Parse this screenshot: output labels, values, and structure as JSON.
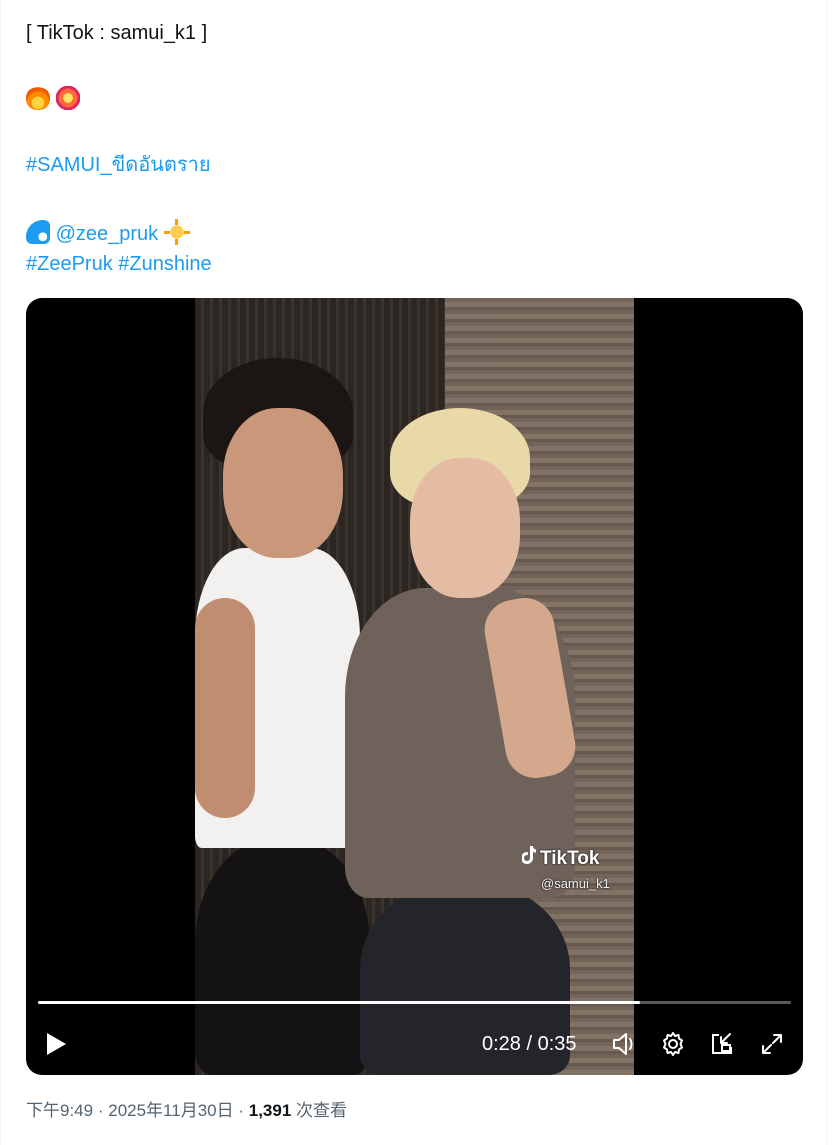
{
  "tweet": {
    "line1": "[ TikTok : samui_k1 ]",
    "emoji_line": [
      "fire-emoji",
      "collision-emoji"
    ],
    "hashtag_samui": "#SAMUI_ขีดอันตราย",
    "mention": "@zee_pruk",
    "hashtag_zeepruk": "#ZeePruk",
    "hashtag_zunshine": "#Zunshine"
  },
  "video": {
    "watermark_brand": "TikTok",
    "watermark_handle": "@samui_k1",
    "time_display": "0:28 / 0:35",
    "progress_fraction": 0.8,
    "controls": [
      "play-icon",
      "volume-icon",
      "settings-gear-icon",
      "picture-in-picture-icon",
      "fullscreen-icon"
    ]
  },
  "meta": {
    "time": "下午9:49",
    "separator": "·",
    "date": "2025年11月30日",
    "views": "1,391",
    "views_label": "次查看"
  },
  "colors": {
    "link": "#1d9bf0",
    "text": "#0f1419",
    "secondary": "#536471",
    "player_bg": "#000000"
  }
}
